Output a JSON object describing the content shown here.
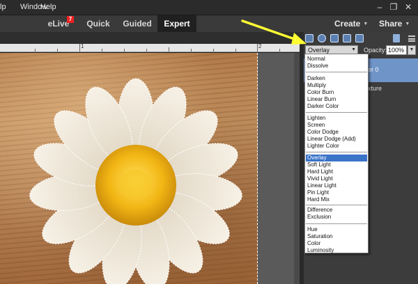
{
  "menubar": {
    "items": [
      "lp",
      "Window",
      "Help"
    ]
  },
  "window_controls": {
    "minimize": "–",
    "restore": "❐",
    "close": "✕"
  },
  "modebar": {
    "tabs": [
      {
        "label": "eLive",
        "badge": "7"
      },
      {
        "label": "Quick"
      },
      {
        "label": "Guided"
      },
      {
        "label": "Expert",
        "active": true
      }
    ],
    "create_label": "Create",
    "share_label": "Share"
  },
  "ruler": {
    "labels": [
      "1",
      "2"
    ]
  },
  "panel": {
    "blend_mode": "Overlay",
    "opacity_label": "Opacity:",
    "opacity_value": "100%",
    "layer_name": "er 0",
    "layer_text": "xture"
  },
  "blend_modes": {
    "groups": [
      [
        "Normal",
        "Dissolve"
      ],
      [
        "Darken",
        "Multiply",
        "Color Burn",
        "Linear Burn",
        "Darker Color"
      ],
      [
        "Lighten",
        "Screen",
        "Color Dodge",
        "Linear Dodge (Add)",
        "Lighter Color"
      ],
      [
        "Overlay",
        "Soft Light",
        "Hard Light",
        "Vivid Light",
        "Linear Light",
        "Pin Light",
        "Hard Mix"
      ],
      [
        "Difference",
        "Exclusion"
      ],
      [
        "Hue",
        "Saturation",
        "Color",
        "Luminosity"
      ]
    ],
    "selected": "Overlay"
  },
  "colors": {
    "annotation_arrow": "#ffff33",
    "selection_highlight": "#3a73c8",
    "layer_highlight": "#6f94c8"
  }
}
